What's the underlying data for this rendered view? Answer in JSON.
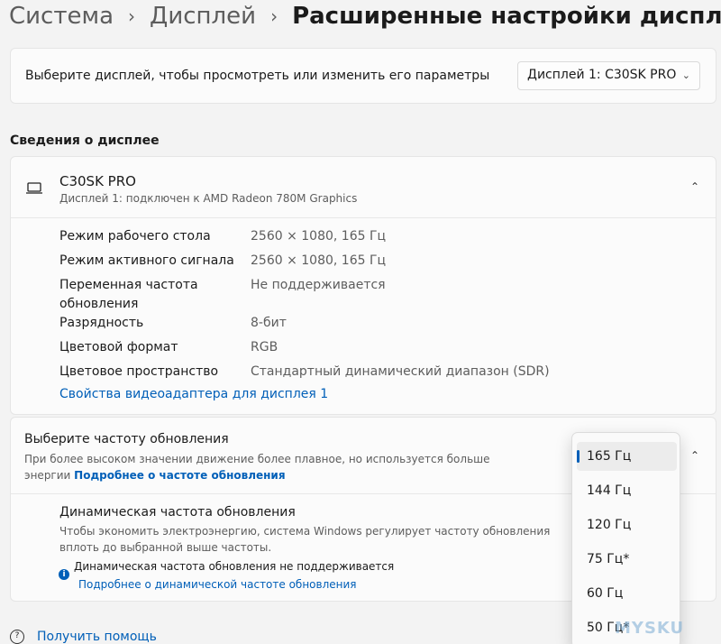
{
  "breadcrumb": {
    "items": [
      "Система",
      "Дисплей"
    ],
    "current": "Расширенные настройки дисплея"
  },
  "display_select": {
    "label": "Выберите дисплей, чтобы просмотреть или изменить его параметры",
    "value": "Дисплей 1: C30SK PRO"
  },
  "info_section": {
    "title": "Сведения о дисплее",
    "monitor_name": "C30SK PRO",
    "monitor_sub": "Дисплей 1: подключен к AMD Radeon 780M Graphics",
    "properties": [
      {
        "label": "Режим рабочего стола",
        "value": "2560 × 1080, 165 Гц"
      },
      {
        "label": "Режим активного сигнала",
        "value": "2560 × 1080, 165 Гц"
      },
      {
        "label": "Переменная частота\nобновления",
        "value": "Не поддерживается"
      },
      {
        "label": "Разрядность",
        "value": "8-бит"
      },
      {
        "label": "Цветовой формат",
        "value": "RGB"
      },
      {
        "label": "Цветовое пространство",
        "value": "Стандартный динамический диапазон (SDR)"
      }
    ],
    "adapter_link": "Свойства видеоадаптера для дисплея 1"
  },
  "refresh": {
    "title": "Выберите частоту обновления",
    "desc": "При более высоком значении движение более плавное, но используется больше энергии",
    "more_link": "Подробнее о частоте обновления",
    "options": [
      "165 Гц",
      "144 Гц",
      "120 Гц",
      "75 Гц*",
      "60 Гц",
      "50 Гц*"
    ],
    "selected": "165 Гц"
  },
  "dynamic": {
    "title": "Динамическая частота обновления",
    "desc": "Чтобы экономить электроэнергию, система Windows регулирует частоту обновления вплоть до выбранной выше частоты.",
    "unsupported": "Динамическая частота обновления не поддерживается",
    "more_link": "Подробнее о динамической частоте обновления"
  },
  "help": {
    "label": "Получить помощь"
  },
  "watermark": "MYSKU",
  "icons": {
    "breadcrumb_separator": "chevron-right-icon",
    "dropdown": "chevron-down-icon",
    "collapse": "chevron-up-icon",
    "monitor": "laptop-icon",
    "info": "info-icon",
    "help": "help-icon"
  },
  "colors": {
    "accent": "#005fb8",
    "background": "#f3f3f3",
    "card": "#fbfbfb"
  }
}
